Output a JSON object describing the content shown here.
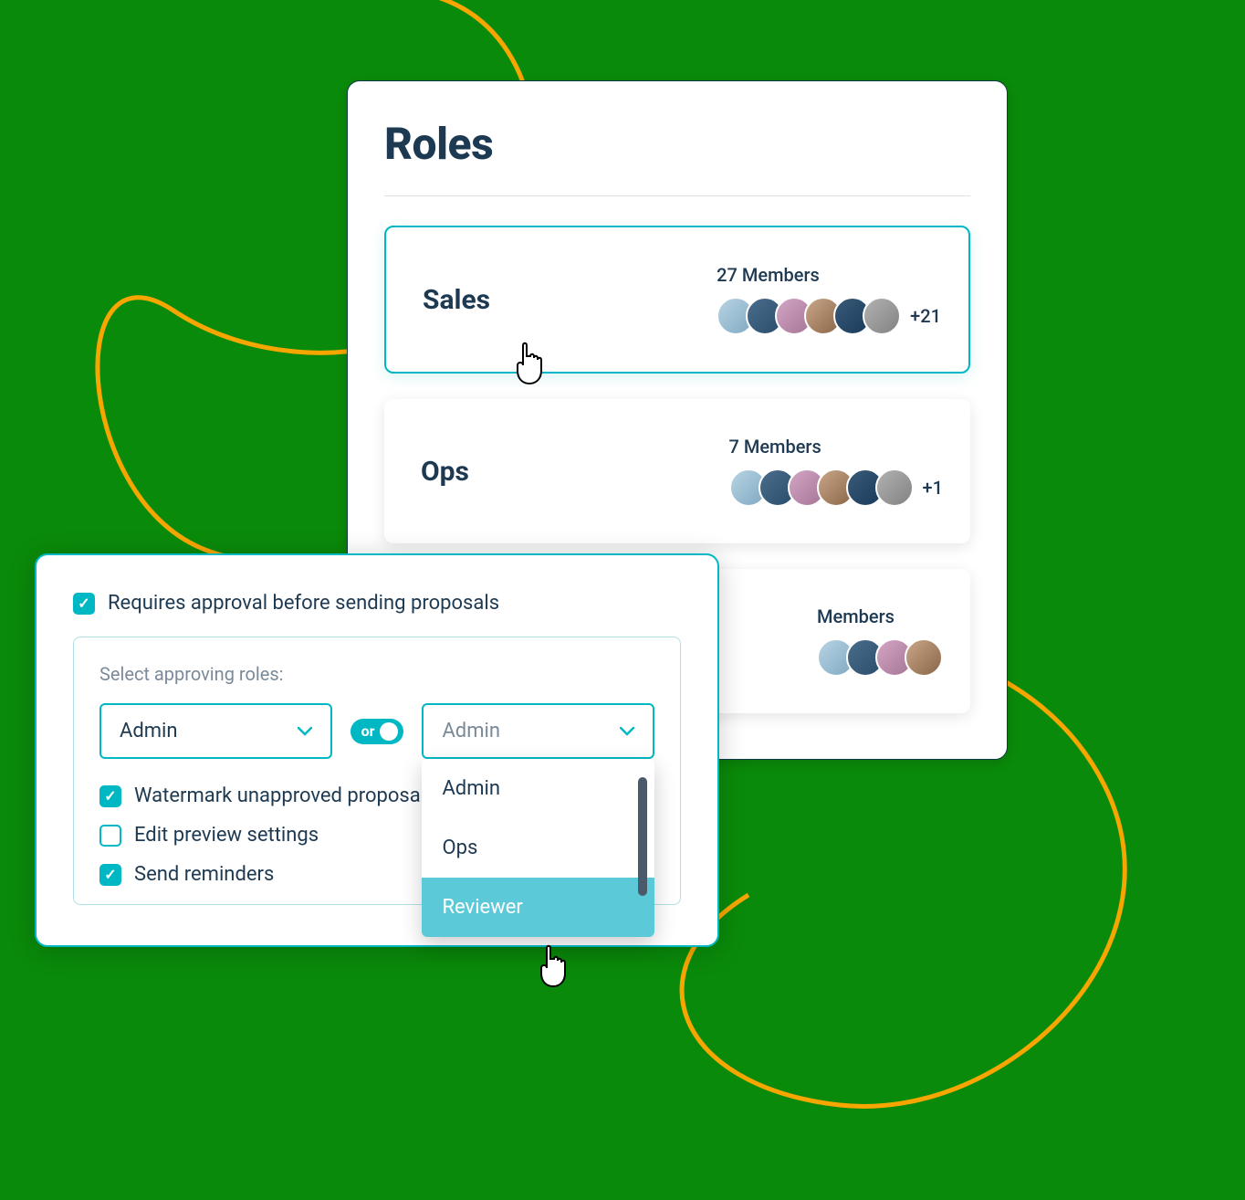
{
  "roles_panel": {
    "title": "Roles",
    "cards": [
      {
        "name": "Sales",
        "members_label": "27 Members",
        "overflow": "+21",
        "selected": true,
        "avatar_count": 6
      },
      {
        "name": "Ops",
        "members_label": "7 Members",
        "overflow": "+1",
        "selected": false,
        "avatar_count": 6
      },
      {
        "name": "",
        "members_label": "Members",
        "overflow": "",
        "selected": false,
        "avatar_count": 4
      }
    ]
  },
  "approval_panel": {
    "requires_approval": {
      "checked": true,
      "label": "Requires approval before sending proposals"
    },
    "approving_roles_label": "Select approving roles:",
    "dropdown_left": {
      "value": "Admin"
    },
    "or_label": "or",
    "dropdown_right": {
      "placeholder": "Admin",
      "options": [
        "Admin",
        "Ops",
        "Reviewer"
      ],
      "highlighted_index": 2
    },
    "watermark": {
      "checked": true,
      "label": "Watermark unapproved proposals"
    },
    "edit_preview": {
      "checked": false,
      "label": "Edit preview settings"
    },
    "send_reminders": {
      "checked": true,
      "label": "Send reminders"
    }
  },
  "colors": {
    "accent": "#00b8c4",
    "text": "#1e3a52",
    "bg": "#0a8a0a"
  }
}
